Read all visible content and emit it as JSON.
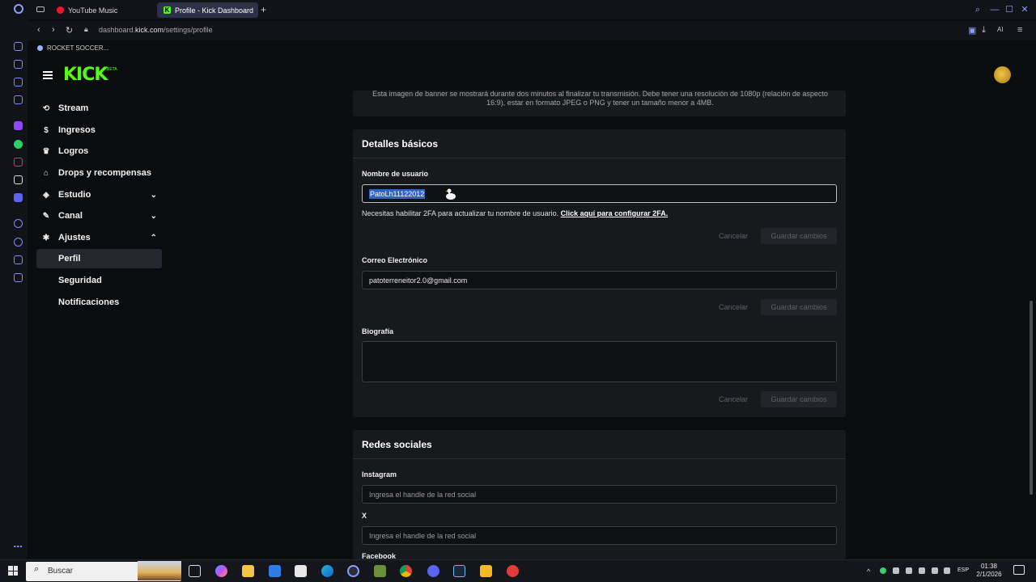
{
  "browser": {
    "tabs": [
      {
        "label": "YouTube Music"
      },
      {
        "label": "Profile - Kick Dashboard"
      }
    ],
    "new_tab": "+",
    "url_prefix": "dashboard.",
    "url_domain": "kick.com",
    "url_path": "/settings/profile",
    "ai_label": "AI"
  },
  "kick": {
    "stream_bar": "ROCKET SOCCER...",
    "logo": "KICK",
    "beta": "BETA",
    "nav": [
      {
        "label": "Stream",
        "icon": "broadcast-icon",
        "glyph": "⟲"
      },
      {
        "label": "Ingresos",
        "icon": "dollar-icon",
        "glyph": "$"
      },
      {
        "label": "Logros",
        "icon": "trophy-icon",
        "glyph": "♛"
      },
      {
        "label": "Drops y recompensas",
        "icon": "gift-icon",
        "glyph": "⌂"
      },
      {
        "label": "Estudio",
        "icon": "studio-icon",
        "glyph": "◈"
      },
      {
        "label": "Canal",
        "icon": "channel-icon",
        "glyph": "✎"
      },
      {
        "label": "Ajustes",
        "icon": "gear-icon",
        "glyph": "✱"
      }
    ],
    "sub_nav": [
      {
        "label": "Perfil"
      },
      {
        "label": "Seguridad"
      },
      {
        "label": "Notificaciones"
      }
    ]
  },
  "banner": {
    "text": "Esta imagen de banner se mostrará durante dos minutos al finalizar tu transmisión. Debe tener una resolución de 1080p (relación de aspecto 16:9), estar en formato JPEG o PNG y tener un tamaño menor a 4MB."
  },
  "basic": {
    "title": "Detalles básicos",
    "username_label": "Nombre de usuario",
    "username_value": "PatoLh11122012",
    "hint": "Necesitas habilitar 2FA para actualizar tu nombre de usuario.",
    "hint_link": "Click aquí para configurar 2FA.",
    "email_label": "Correo Electrónico",
    "email_value": "patoterreneitor2.0@gmail.com",
    "bio_label": "Biografía",
    "cancel": "Cancelar",
    "save": "Guardar cambios"
  },
  "social": {
    "title": "Redes sociales",
    "instagram_label": "Instagram",
    "x_label": "X",
    "facebook_label": "Facebook",
    "placeholder": "Ingresa el handle de la red social"
  },
  "taskbar": {
    "search": "Buscar",
    "lang": "ESP",
    "time": "01:38",
    "date": "2/1/2026"
  },
  "colors": {
    "kick_green": "#53fc18",
    "selection": "#2f63c9",
    "panel": "#17191d"
  }
}
